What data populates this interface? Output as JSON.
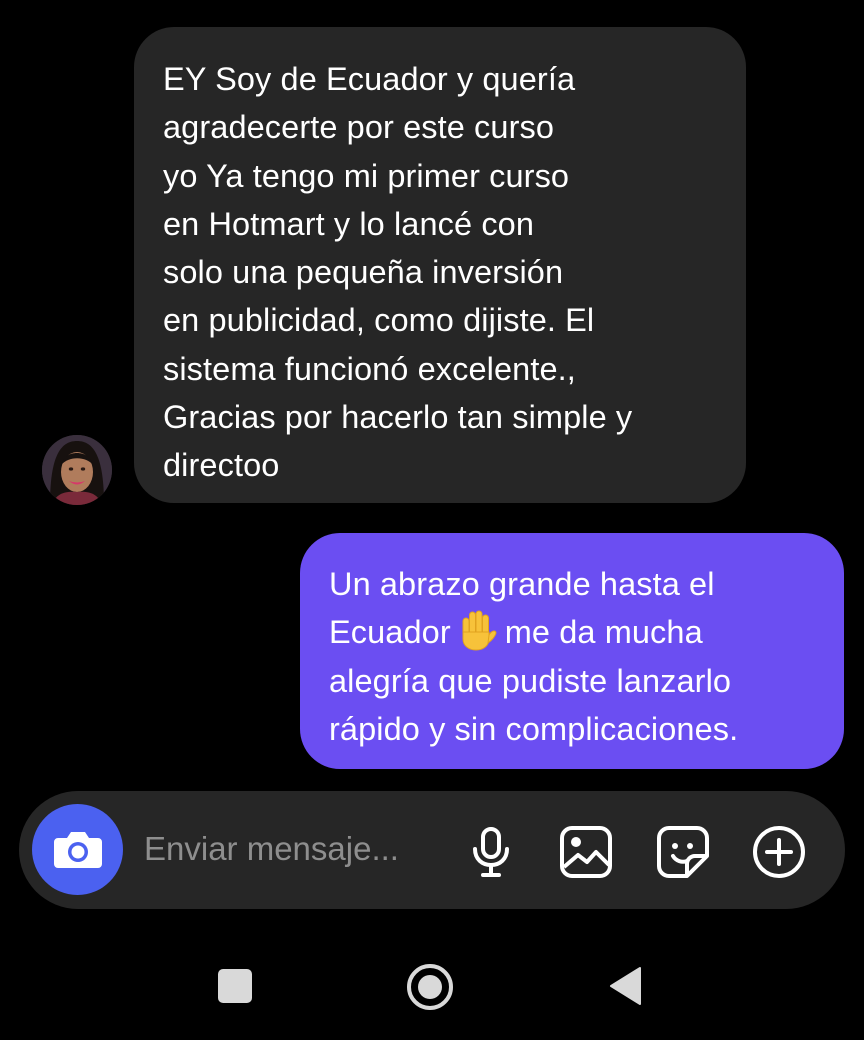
{
  "conversation": {
    "incoming": {
      "lines": [
        "EY Soy de Ecuador y quería",
        "agradecerte por este curso",
        "yo  Ya tengo mi primer curso",
        "en Hotmart y lo lancé con",
        "solo una pequeña inversión",
        "en publicidad, como dijiste. El",
        "sistema funcionó excelente.,",
        "Gracias por hacerlo tan simple y",
        "directoo"
      ],
      "bubble_color": "#262626"
    },
    "outgoing": {
      "line1": "Un abrazo grande hasta el",
      "line2_before": "Ecuador",
      "line2_emoji": "raised-hand-emoji",
      "line2_after": "me da mucha",
      "line3": "alegría que pudiste lanzarlo",
      "line4": "rápido y sin complicaciones.",
      "bubble_color": "#6b4ef2"
    }
  },
  "composer": {
    "placeholder": "Enviar mensaje...",
    "camera_icon": "camera-icon",
    "tools": [
      "microphone-icon",
      "image-icon",
      "sticker-icon",
      "plus-circle-icon"
    ],
    "accent_color": "#4b61f0"
  },
  "navbar": {
    "buttons": [
      "recents-icon",
      "home-icon",
      "back-icon"
    ]
  }
}
